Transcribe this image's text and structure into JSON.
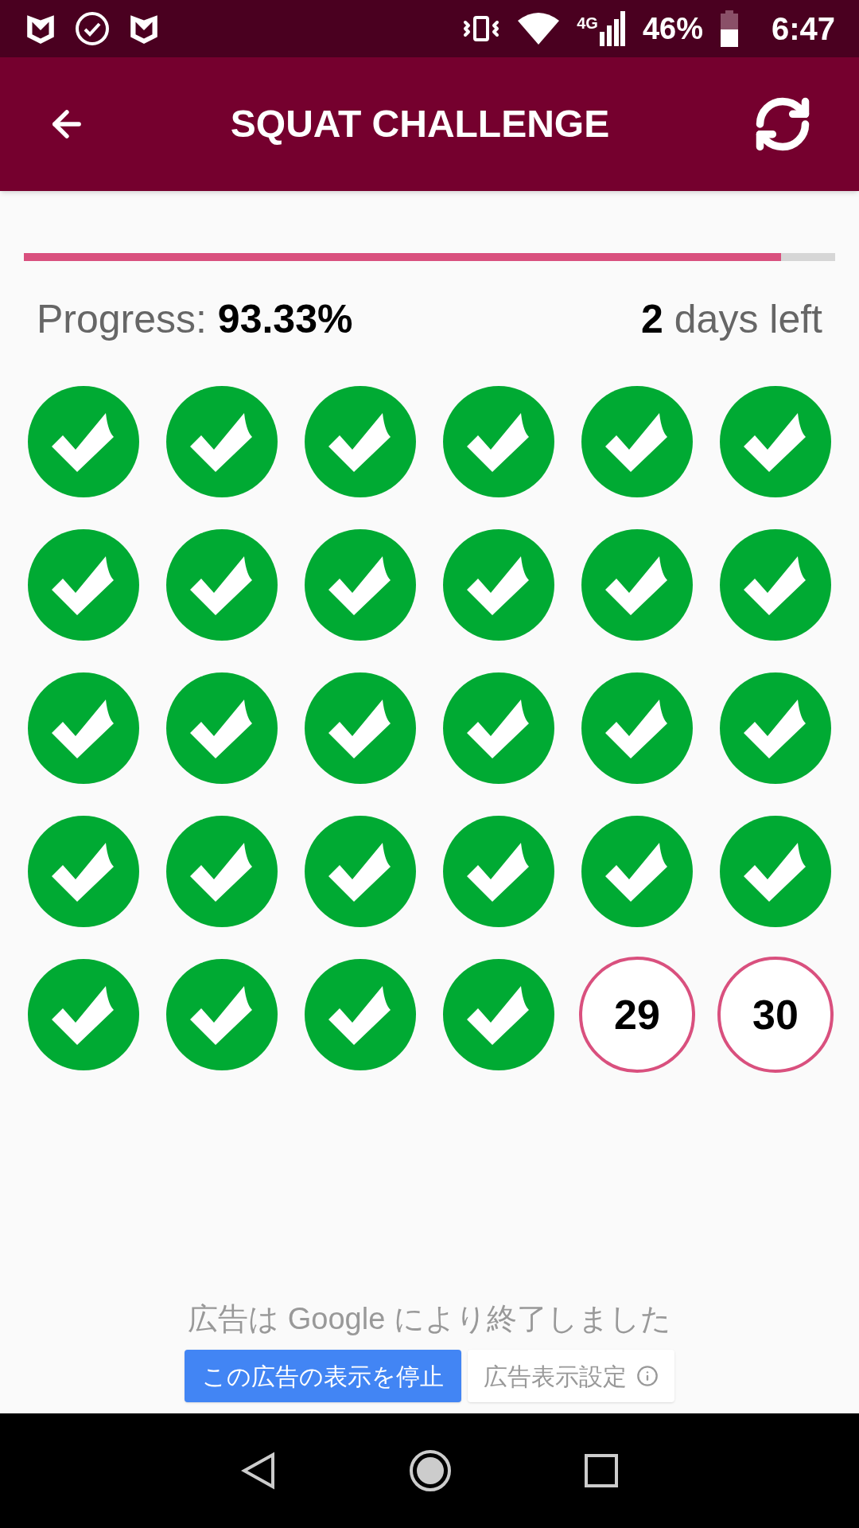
{
  "status_bar": {
    "network": "4G",
    "battery": "46%",
    "time": "6:47"
  },
  "app_bar": {
    "title": "SQUAT CHALLENGE"
  },
  "progress": {
    "level": 0.9333,
    "label": "Progress: ",
    "value": "93.33%",
    "days_count": "2",
    "days_text": " days left"
  },
  "days": [
    {
      "done": true
    },
    {
      "done": true
    },
    {
      "done": true
    },
    {
      "done": true
    },
    {
      "done": true
    },
    {
      "done": true
    },
    {
      "done": true
    },
    {
      "done": true
    },
    {
      "done": true
    },
    {
      "done": true
    },
    {
      "done": true
    },
    {
      "done": true
    },
    {
      "done": true
    },
    {
      "done": true
    },
    {
      "done": true
    },
    {
      "done": true
    },
    {
      "done": true
    },
    {
      "done": true
    },
    {
      "done": true
    },
    {
      "done": true
    },
    {
      "done": true
    },
    {
      "done": true
    },
    {
      "done": true
    },
    {
      "done": true
    },
    {
      "done": true
    },
    {
      "done": true
    },
    {
      "done": true
    },
    {
      "done": true
    },
    {
      "done": false,
      "label": "29"
    },
    {
      "done": false,
      "label": "30"
    }
  ],
  "ad": {
    "message": "広告は Google により終了しました",
    "stop_button": "この広告の表示を停止",
    "settings_button": "広告表示設定"
  }
}
